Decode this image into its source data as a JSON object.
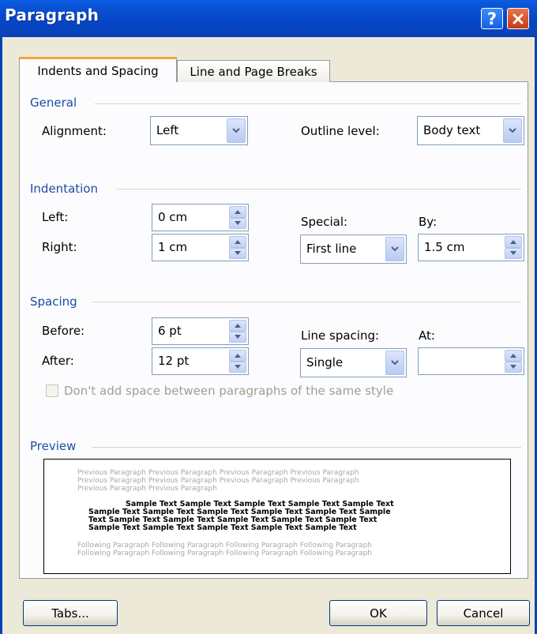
{
  "window": {
    "title": "Paragraph",
    "help_glyph": "?"
  },
  "tabs": [
    {
      "label": "Indents and Spacing",
      "selected": true
    },
    {
      "label": "Line and Page Breaks",
      "selected": false
    }
  ],
  "general": {
    "heading": "General",
    "alignment_label": "Alignment:",
    "alignment_value": "Left",
    "outline_label": "Outline level:",
    "outline_value": "Body text"
  },
  "indentation": {
    "heading": "Indentation",
    "left_label": "Left:",
    "left_value": "0 cm",
    "right_label": "Right:",
    "right_value": "1 cm",
    "special_label": "Special:",
    "special_value": "First line",
    "by_label": "By:",
    "by_value": "1.5 cm"
  },
  "spacing": {
    "heading": "Spacing",
    "before_label": "Before:",
    "before_value": "6 pt",
    "after_label": "After:",
    "after_value": "12 pt",
    "line_spacing_label": "Line spacing:",
    "line_spacing_value": "Single",
    "at_label": "At:",
    "at_value": "",
    "checkbox_label": "Don't add space between paragraphs of the same style",
    "checkbox_checked": false
  },
  "preview": {
    "heading": "Preview",
    "previous_lines": [
      "Previous Paragraph Previous Paragraph Previous Paragraph Previous Paragraph",
      "Previous Paragraph Previous Paragraph Previous Paragraph Previous Paragraph",
      "Previous Paragraph Previous Paragraph"
    ],
    "sample_lines": [
      "Sample Text Sample Text Sample Text Sample Text Sample Text",
      "Sample Text Sample Text Sample Text Sample Text Sample Text Sample",
      "Text Sample Text Sample Text Sample Text Sample Text Sample Text",
      "Sample Text Sample Text Sample Text Sample Text Sample Text"
    ],
    "following_lines": [
      "Following Paragraph Following Paragraph Following Paragraph Following Paragraph",
      "Following Paragraph Following Paragraph Following Paragraph Following Paragraph"
    ]
  },
  "buttons": {
    "tabs": "Tabs...",
    "ok": "OK",
    "cancel": "Cancel"
  },
  "colors": {
    "titlebar": "#0842b9",
    "section_heading": "#1b4ea1",
    "face": "#ece9d8"
  }
}
